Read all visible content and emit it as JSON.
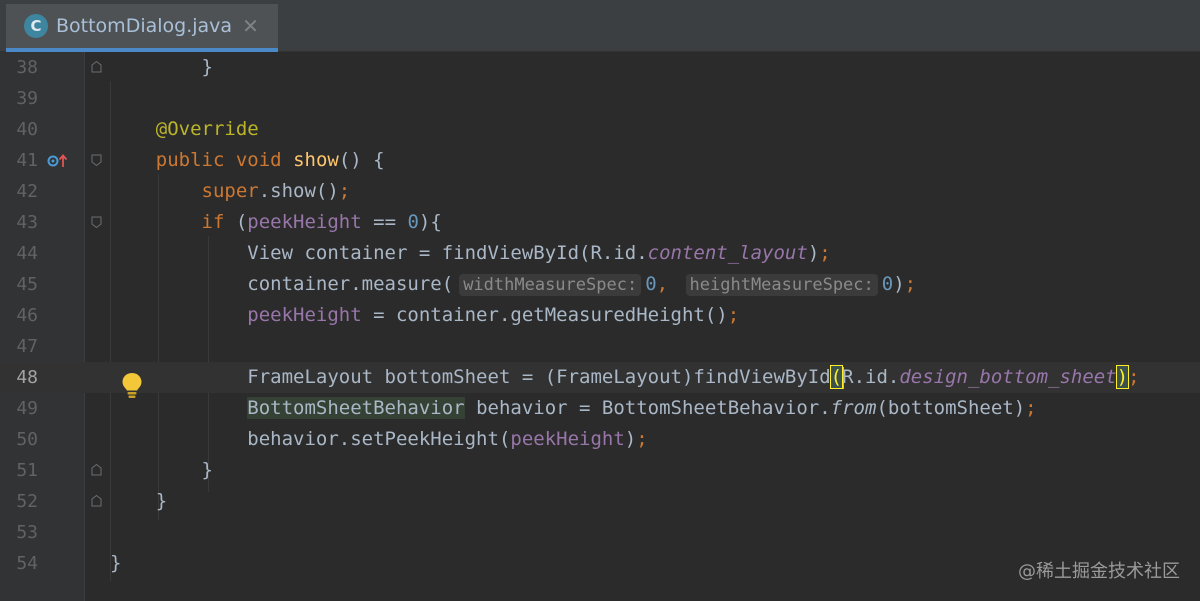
{
  "tab": {
    "label": "BottomDialog.java",
    "icon_letter": "C",
    "close": "✕"
  },
  "editor": {
    "current_line": "48",
    "lines": [
      {
        "num": "38",
        "parts": [
          "}"
        ]
      },
      {
        "num": "39"
      },
      {
        "num": "40",
        "parts": [
          "@Override"
        ]
      },
      {
        "num": "41",
        "parts": [
          "public",
          " ",
          "void",
          " ",
          "show",
          "() {"
        ]
      },
      {
        "num": "42",
        "parts": [
          "super",
          ".show()",
          ";"
        ]
      },
      {
        "num": "43",
        "parts": [
          "if",
          " (",
          "peekHeight",
          " == ",
          "0",
          "){"
        ]
      },
      {
        "num": "44",
        "parts": [
          "View container = findViewById(R.id.",
          "content_layout",
          ")",
          ";"
        ]
      },
      {
        "num": "45",
        "parts": [
          "container.measure(",
          "widthMeasureSpec:",
          "0",
          ", ",
          "heightMeasureSpec:",
          "0",
          ")",
          ";"
        ]
      },
      {
        "num": "46",
        "parts": [
          "peekHeight",
          " = container.getMeasuredHeight()",
          ";"
        ]
      },
      {
        "num": "47"
      },
      {
        "num": "48",
        "parts": [
          "FrameLayout bottomSheet = (FrameLayout)findViewById",
          "(",
          "R.id.",
          "design_bottom_sheet",
          ")",
          ";"
        ]
      },
      {
        "num": "49",
        "parts": [
          "BottomSheetBehavior",
          " behavior = BottomSheetBehavior.",
          "from",
          "(bottomSheet)",
          ";"
        ]
      },
      {
        "num": "50",
        "parts": [
          "behavior.setPeekHeight(",
          "peekHeight",
          ")",
          ";"
        ]
      },
      {
        "num": "51",
        "parts": [
          "}"
        ]
      },
      {
        "num": "52",
        "parts": [
          "}"
        ]
      },
      {
        "num": "53"
      },
      {
        "num": "54",
        "parts": [
          "}"
        ]
      }
    ]
  },
  "watermark": "@稀土掘金技术社区",
  "colors": {
    "background": "#2b2b2b",
    "gutter": "#313335",
    "keyword": "#cc7832",
    "method": "#ffc66d",
    "annotation": "#bbb529",
    "field": "#9876aa",
    "number": "#6897bb",
    "text": "#a9b7c6"
  },
  "icons": [
    "class-file-icon",
    "close-tab-icon",
    "override-method-icon",
    "fold-marker-icon",
    "intention-bulb-icon"
  ]
}
